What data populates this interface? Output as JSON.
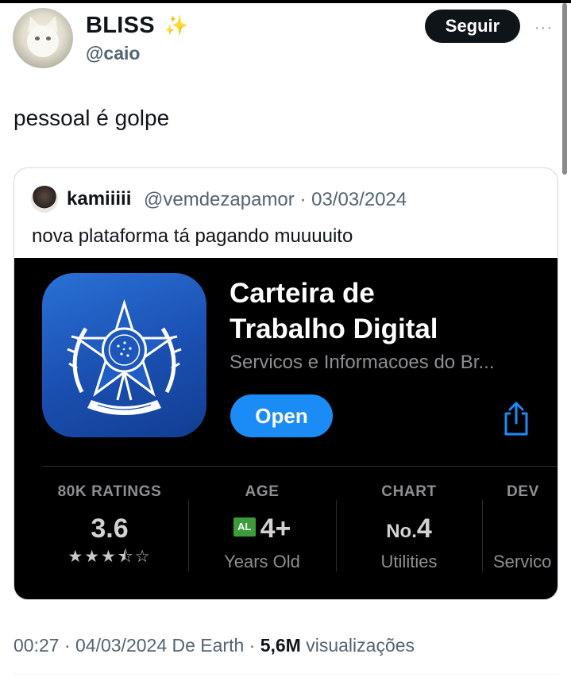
{
  "author": {
    "display_name": "BLISS",
    "sparkle_icon": "✨",
    "handle": "@caio",
    "avatar_icon": "white-cat-avatar"
  },
  "follow_label": "Seguir",
  "more_icon": "···",
  "tweet_text": "pessoal é golpe",
  "quoted": {
    "name": "kamiiiii",
    "meta": "@vemdezapamor · 03/03/2024",
    "text": "nova plataforma tá pagando muuuuito",
    "app": {
      "title": "Carteira de Trabalho Digital",
      "subtitle": "Servicos e Informacoes do Br...",
      "open_label": "Open",
      "icon": "brazil-coat-of-arms-icon",
      "stats": {
        "ratings": {
          "label": "80K RATINGS",
          "value": "3.6",
          "stars": "★★★⯪☆",
          "rating_stars_filled": 3.5,
          "rating_stars_total": 5
        },
        "age": {
          "label": "AGE",
          "badge": "AL",
          "value": "4+",
          "foot": "Years Old"
        },
        "chart": {
          "label": "CHART",
          "prefix": "No.",
          "value": "4",
          "foot": "Utilities"
        },
        "developer": {
          "label": "DEV",
          "foot": "Servico"
        }
      }
    }
  },
  "footer": {
    "time_date": "00:27 · 04/03/2024 De Earth · ",
    "views_count": "5,6M",
    "views_label": " visualizações"
  },
  "colors": {
    "follow_button": "#0f1419",
    "open_button": "#1b8cf5",
    "app_icon": "#1a4fb0",
    "muted_text": "#536471"
  }
}
